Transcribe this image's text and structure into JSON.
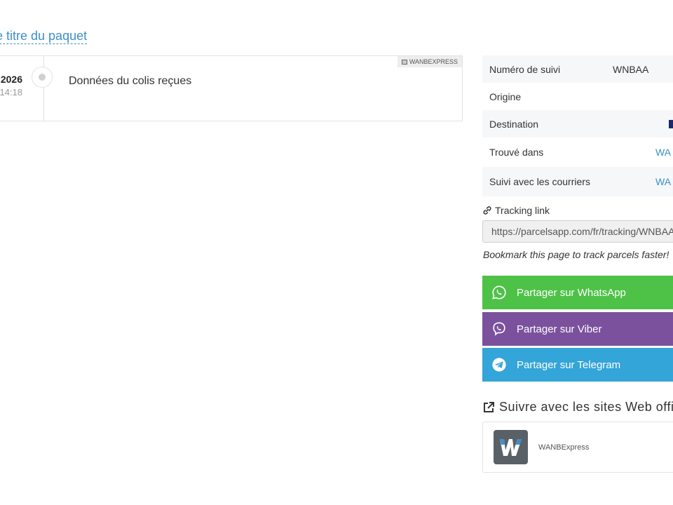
{
  "header": {
    "edit_title_link": "e titre du paquet"
  },
  "event": {
    "date": "2026",
    "time": "14:18",
    "description": "Données du colis reçues",
    "courier_badge": "WANBEXPRESS"
  },
  "info_table": {
    "rows": [
      {
        "label": "Numéro de suivi",
        "value": "WNBAA"
      },
      {
        "label": "Origine",
        "value": ""
      },
      {
        "label": "Destination",
        "value": ""
      },
      {
        "label": "Trouvé dans",
        "value": "WA"
      },
      {
        "label": "Suivi avec les courriers",
        "value": "WA"
      }
    ],
    "destination_flag_color": "#1a2a6c",
    "link_color": "#3d8fc8"
  },
  "tracking": {
    "label": "Tracking link",
    "url": "https://parcelsapp.com/fr/tracking/WNBAA",
    "bookmark_note": "Bookmark this page to track parcels faster!"
  },
  "share": {
    "whatsapp": {
      "label": "Partager sur WhatsApp",
      "color": "#4dc247",
      "icon": "whatsapp-icon"
    },
    "viber": {
      "label": "Partager sur Viber",
      "color": "#7b519d",
      "icon": "viber-icon"
    },
    "telegram": {
      "label": "Partager sur Telegram",
      "color": "#34a5d8",
      "icon": "telegram-icon"
    }
  },
  "official_sites": {
    "title": "Suivre avec les sites Web offi",
    "courier_name": "WANBExpress"
  }
}
